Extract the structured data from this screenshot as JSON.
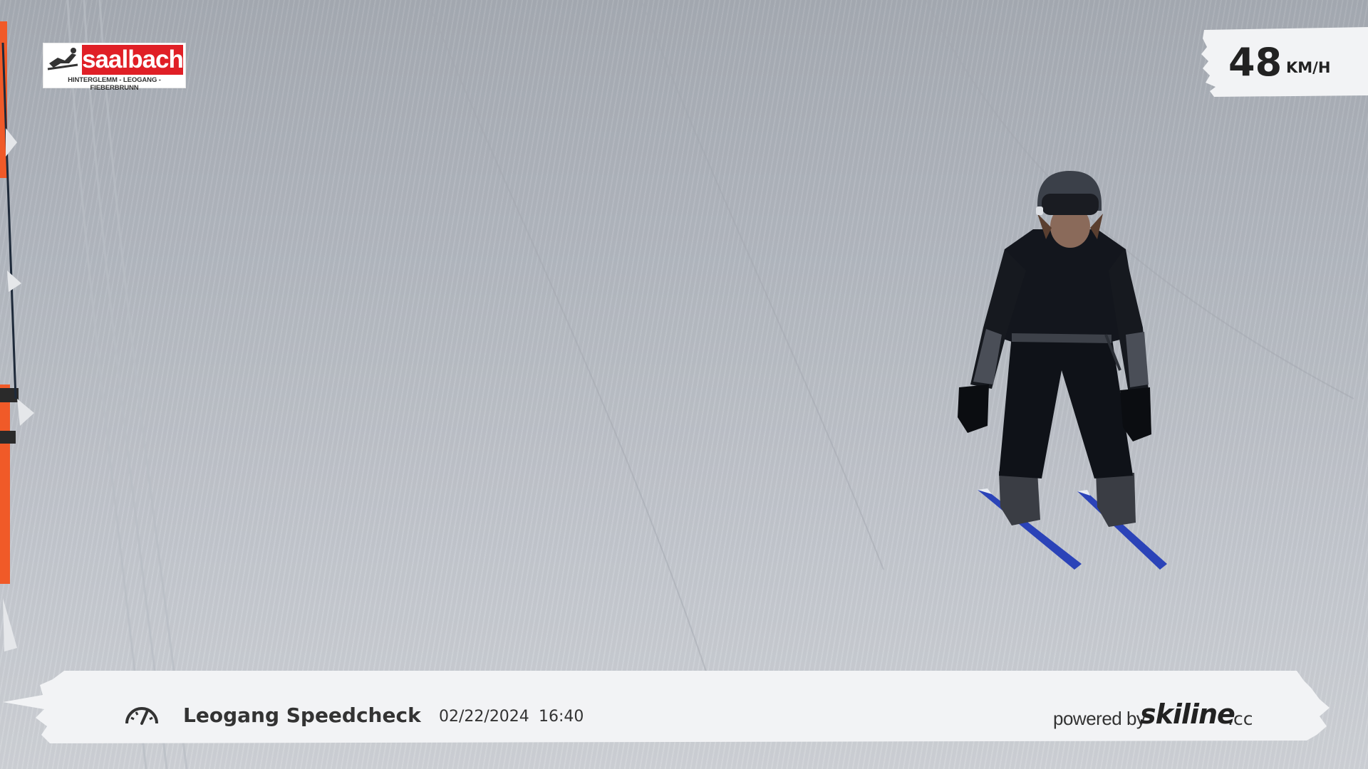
{
  "logo": {
    "brand": "saalbach",
    "tagline": "HINTERGLEMM - LEOGANG - FIEBERBRUNN",
    "icon": "skier-icon"
  },
  "speed": {
    "value": "48",
    "unit": "KM/H"
  },
  "info": {
    "icon": "speedometer-icon",
    "location": "Leogang Speedcheck",
    "date": "02/22/2024",
    "time": "16:40",
    "powered_by": "powered by",
    "brand_name": "skiline",
    "brand_tld": ".cc"
  },
  "colors": {
    "logo_red": "#e01f26",
    "snow": "#c3c7ce",
    "banner": "#f2f3f5",
    "text": "#333333",
    "ski_blue": "#2b43b8",
    "fence_orange": "#f05a28"
  }
}
